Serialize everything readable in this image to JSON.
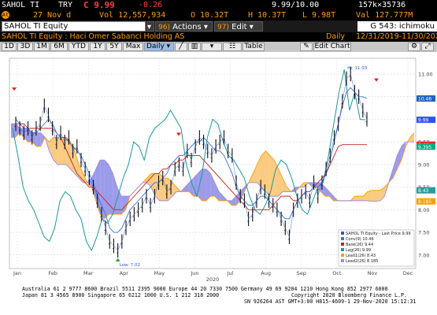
{
  "quote": {
    "ticker": "SAHOL TI",
    "currency": "TRY",
    "price": "C 9.99",
    "change": "-0.26",
    "bid_ask": "9.99/10.00",
    "size": "157k×35736"
  },
  "quote2": {
    "at": "At",
    "date": "27 Nov d",
    "volume": "Vol 12,557,934",
    "open": "O 10.32T",
    "high": "H 10.37T",
    "low": "L 9.98T",
    "value": "Val 127.777M"
  },
  "toolbar": {
    "security_field": "SAHOL TI Equity",
    "actions_num": "96)",
    "actions_label": "Actions",
    "edit_num": "97)",
    "edit_label": "Edit",
    "function": "G 543: ichimoku"
  },
  "title_bar": {
    "security": "SAHOL TI Equity : Haci Omer Sabanci Holding AS",
    "period": "Daily",
    "range": "12/31/2019-11/30/2020"
  },
  "periods": [
    "1D",
    "3D",
    "1M",
    "6M",
    "YTD",
    "1Y",
    "5Y",
    "Max"
  ],
  "period_selected": "Daily",
  "view_buttons": {
    "table": "Table",
    "edit_chart": "Edit Chart"
  },
  "chart_data": {
    "type": "line",
    "x_labels": [
      "Jan",
      "Feb",
      "Mar",
      "Apr",
      "May",
      "Jun",
      "Jul",
      "Aug",
      "Sep",
      "Oct",
      "Nov",
      "Dec"
    ],
    "year_label": "2020",
    "y_ticks": [
      7.0,
      7.5,
      8.0,
      8.5,
      9.0,
      9.5,
      10.0,
      10.5,
      11.0
    ],
    "ylim": [
      6.7,
      11.35
    ],
    "annotations": {
      "high": "Hi: 11.03",
      "low": "Low: 7.02"
    },
    "right_labels": [
      {
        "text": "10.46",
        "value": 10.46,
        "color": "#2060c0"
      },
      {
        "text": "9.99",
        "value": 9.99,
        "color": "#3050ff"
      },
      {
        "text": "9.44",
        "value": 9.44,
        "color": "#ff2020"
      },
      {
        "text": "9.395",
        "value": 9.395,
        "color": "#00b080"
      },
      {
        "text": "8.43",
        "value": 8.43,
        "color": "#2b9a9a"
      },
      {
        "text": "8.185",
        "value": 8.185,
        "color": "#ff9c00"
      }
    ],
    "legend": [
      {
        "label": "SAHOL TI Equity - Last Price",
        "value": "9.99",
        "color": "#2a57c7"
      },
      {
        "label": "Conv(9)",
        "value": "10.46",
        "color": "#3b6fd8"
      },
      {
        "label": "Base(26)",
        "value": "9.44",
        "color": "#c82020"
      },
      {
        "label": "Lag(26)",
        "value": "9.99",
        "color": "#1a9a9a"
      },
      {
        "label": "Lead1(26)",
        "value": "8.43",
        "color": "#ff9c00"
      },
      {
        "label": "Lead2(26)",
        "value": "8.185",
        "color": "#9a8ae8"
      }
    ],
    "price": [
      9.9,
      9.8,
      9.7,
      9.8,
      9.6,
      9.8,
      9.9,
      10.3,
      10.1,
      9.8,
      9.5,
      9.7,
      9.5,
      9.6,
      9.3,
      9.4,
      9.1,
      8.9,
      8.7,
      8.5,
      8.2,
      7.9,
      7.6,
      7.3,
      7.2,
      7.1,
      7.3,
      7.6,
      7.8,
      7.9,
      8.0,
      8.1,
      8.3,
      8.1,
      8.3,
      8.6,
      8.7,
      8.4,
      8.5,
      8.9,
      9.0,
      8.9,
      9.3,
      9.1,
      9.4,
      9.6,
      9.5,
      9.3,
      9.2,
      9.4,
      9.5,
      9.6,
      9.3,
      9.2,
      8.6,
      8.3,
      8.2,
      7.8,
      7.9,
      8.2,
      8.5,
      8.4,
      8.2,
      8.1,
      8.0,
      7.8,
      7.6,
      7.4,
      8.0,
      8.2,
      8.3,
      8.4,
      8.2,
      8.6,
      8.3,
      8.6,
      8.9,
      9.2,
      9.6,
      9.9,
      10.4,
      10.9,
      11.0,
      10.6,
      10.5,
      10.2,
      10.0
    ],
    "conv": [
      10.0,
      9.9,
      9.8,
      9.8,
      9.7,
      9.7,
      9.8,
      9.9,
      10.0,
      9.9,
      9.7,
      9.6,
      9.6,
      9.5,
      9.4,
      9.3,
      9.2,
      9.0,
      8.8,
      8.6,
      8.3,
      8.1,
      7.9,
      7.6,
      7.5,
      7.5,
      7.6,
      7.8,
      8.0,
      8.1,
      8.2,
      8.3,
      8.4,
      8.5,
      8.6,
      8.6,
      8.7,
      8.8,
      9.0,
      9.1,
      9.2,
      9.2,
      9.3,
      9.4,
      9.5,
      9.5,
      9.6,
      9.5,
      9.4,
      9.3,
      9.3,
      9.2,
      9.0,
      8.8,
      8.5,
      8.3,
      8.2,
      8.1,
      8.1,
      8.2,
      8.3,
      8.3,
      8.2,
      8.1,
      8.0,
      7.9,
      7.8,
      7.8,
      8.0,
      8.2,
      8.3,
      8.4,
      8.4,
      8.5,
      8.5,
      8.6,
      8.8,
      9.1,
      9.5,
      9.9,
      10.3,
      10.6,
      10.7,
      10.6,
      10.5,
      10.5,
      10.46
    ],
    "base": [
      9.9,
      9.9,
      9.9,
      9.8,
      9.8,
      9.8,
      9.8,
      9.8,
      9.8,
      9.8,
      9.7,
      9.6,
      9.4,
      9.2,
      9.0,
      8.8,
      8.7,
      8.6,
      8.5,
      8.5,
      8.4,
      8.3,
      8.2,
      8.1,
      8.0,
      8.0,
      8.0,
      8.1,
      8.2,
      8.3,
      8.4,
      8.5,
      8.6,
      8.7,
      8.8,
      8.8,
      8.9,
      8.9,
      9.0,
      9.0,
      9.1,
      9.1,
      9.2,
      9.2,
      9.2,
      9.2,
      9.1,
      9.0,
      8.9,
      8.8,
      8.7,
      8.6,
      8.5,
      8.4,
      8.3,
      8.2,
      8.1,
      8.0,
      8.0,
      8.0,
      8.0,
      8.0,
      8.0,
      8.1,
      8.2,
      8.3,
      8.3,
      8.3,
      8.2,
      8.2,
      8.3,
      8.4,
      8.4,
      8.5,
      8.6,
      8.7,
      8.8,
      9.0,
      9.2,
      9.4,
      9.44,
      9.44,
      9.44,
      9.44,
      9.44,
      9.44,
      9.44
    ],
    "lag": [
      9.8,
      9.2,
      8.5,
      8.2,
      8.0,
      7.7,
      7.4,
      7.3,
      7.6,
      8.2,
      8.4,
      8.3,
      8.0,
      7.8,
      7.3,
      7.1,
      7.4,
      7.8,
      7.7,
      7.9,
      8.3,
      8.7,
      9.0,
      9.5,
      9.4,
      9.1,
      9.6,
      9.8,
      9.9,
      10.0,
      10.2,
      10.0,
      9.8,
      9.0,
      8.6,
      8.3,
      8.8,
      9.6,
      10.0,
      9.9,
      9.5,
      9.2,
      9.1,
      8.9,
      8.7,
      8.3,
      8.0,
      7.9,
      8.1,
      8.4,
      8.9,
      9.1,
      9.0,
      8.7,
      8.3,
      8.0,
      7.9,
      8.2,
      8.5,
      8.6,
      9.2,
      9.9,
      10.6,
      11.1,
      10.2,
      10.6,
      10.0,
      9.99
    ],
    "lead1": [
      9.6,
      9.6,
      9.7,
      9.6,
      9.5,
      9.5,
      9.4,
      9.4,
      9.6,
      9.5,
      9.6,
      9.6,
      9.6,
      9.6,
      9.5,
      9.3,
      9.0,
      8.8,
      8.6,
      8.5,
      8.2,
      7.9,
      7.8,
      7.9,
      7.9,
      7.9,
      7.9,
      8.0,
      8.3,
      8.4,
      8.5,
      8.6,
      8.7,
      8.8,
      8.8,
      8.8,
      8.7,
      8.7,
      8.6,
      8.5,
      8.4,
      8.4,
      8.4,
      8.3,
      8.3,
      8.2,
      8.2,
      8.3,
      8.3,
      8.2,
      8.2,
      8.2,
      8.1,
      8.1,
      8.2,
      8.4,
      8.6,
      8.8,
      9.0,
      9.2,
      9.3,
      9.2,
      9.1,
      8.9,
      8.7,
      8.5,
      8.4,
      8.4,
      8.5,
      8.6,
      8.6,
      8.5,
      8.5,
      8.4,
      8.3,
      8.3,
      8.2,
      8.2,
      8.2,
      8.2,
      8.2,
      8.3,
      8.3,
      8.3,
      8.4,
      8.43,
      8.43,
      8.43,
      8.5,
      8.6,
      8.7,
      8.9,
      9.1,
      9.4,
      9.6,
      9.7
    ],
    "lead2": [
      9.9,
      9.9,
      9.8,
      9.8,
      9.8,
      9.7,
      9.7,
      9.7,
      9.6,
      9.3,
      9.1,
      9.0,
      9.0,
      9.0,
      8.9,
      8.8,
      8.7,
      8.6,
      8.6,
      8.7,
      8.9,
      9.1,
      9.1,
      9.0,
      8.8,
      8.5,
      8.3,
      8.3,
      8.3,
      8.4,
      8.5,
      8.6,
      8.6,
      8.5,
      8.3,
      8.2,
      8.2,
      8.2,
      8.3,
      8.4,
      8.4,
      8.5,
      8.6,
      8.7,
      8.8,
      8.9,
      8.9,
      8.8,
      8.6,
      8.4,
      8.3,
      8.2,
      8.2,
      8.3,
      8.4,
      8.5,
      8.6,
      8.6,
      8.6,
      8.5,
      8.4,
      8.3,
      8.3,
      8.3,
      8.4,
      8.4,
      8.4,
      8.5,
      8.5,
      8.5,
      8.6,
      8.6,
      8.6,
      8.6,
      8.5,
      8.4,
      8.3,
      8.2,
      8.2,
      8.2,
      8.2,
      8.2,
      8.2,
      8.2,
      8.2,
      8.185,
      8.185,
      8.2,
      8.3,
      8.6,
      8.9,
      9.2,
      9.4,
      9.5,
      9.5,
      9.5
    ]
  },
  "footer": {
    "line1": "Australia 61 2 9777 8600  Brazil 5511 2395 9000  Europe 44 20 7330 7500  Germany 49 69 9204 1210  Hong Kong 852 2977 6000",
    "line2": "Japan 81 3 4565 8900        Singapore 65 6212 1000        U.S. 1 212 318 2000",
    "line3": "Copyright 2020 Bloomberg Finance L.P.",
    "line4": "SN 926264 AST  GMT+3:00 H815-4609-1 29-Nov-2020 15:12:31"
  }
}
